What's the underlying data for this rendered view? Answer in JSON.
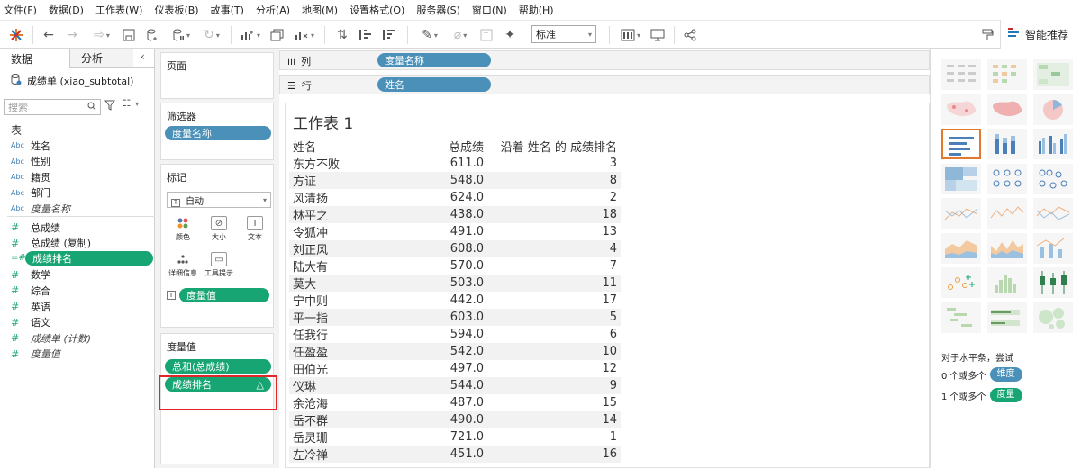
{
  "menu": [
    "文件(F)",
    "数据(D)",
    "工作表(W)",
    "仪表板(B)",
    "故事(T)",
    "分析(A)",
    "地图(M)",
    "设置格式(O)",
    "服务器(S)",
    "窗口(N)",
    "帮助(H)"
  ],
  "toolbar": {
    "view_size": "标准",
    "smart_tab": "智能推荐"
  },
  "data_pane": {
    "tab_data": "数据",
    "tab_analysis": "分析",
    "datasource": "成绩单 (xiao_subtotal)",
    "search_placeholder": "搜索",
    "table_heading": "表",
    "dimensions": [
      {
        "type": "Abc",
        "name": "姓名"
      },
      {
        "type": "Abc",
        "name": "性别"
      },
      {
        "type": "Abc",
        "name": "籍贯"
      },
      {
        "type": "Abc",
        "name": "部门"
      },
      {
        "type": "Abc",
        "name": "度量名称"
      }
    ],
    "measures": [
      {
        "type": "#",
        "name": "总成绩"
      },
      {
        "type": "#",
        "name": "总成绩 (复制)"
      },
      {
        "type": "=#",
        "name": "成绩排名"
      },
      {
        "type": "#",
        "name": "数学"
      },
      {
        "type": "#",
        "name": "综合"
      },
      {
        "type": "#",
        "name": "英语"
      },
      {
        "type": "#",
        "name": "语文"
      },
      {
        "type": "#",
        "name": "成绩单 (计数)"
      },
      {
        "type": "#",
        "name": "度量值"
      }
    ]
  },
  "mid_pane": {
    "pages_title": "页面",
    "filters_title": "筛选器",
    "filter_pill": "度量名称",
    "marks_title": "标记",
    "mark_type": "自动",
    "mark_buttons": [
      "颜色",
      "大小",
      "文本",
      "详细信息",
      "工具提示"
    ],
    "marks_pill": "度量值",
    "measure_values_title": "度量值",
    "mv_pills": [
      "总和(总成绩)",
      "成绩排名"
    ],
    "delta_symbol": "△"
  },
  "shelves": {
    "columns_label": "列",
    "columns_pill": "度量名称",
    "rows_label": "行",
    "rows_pill": "姓名"
  },
  "sheet": {
    "title": "工作表 1",
    "headers": [
      "姓名",
      "总成绩",
      "沿着 姓名 的 成绩排名"
    ],
    "rows": [
      [
        "东方不败",
        "611.0",
        "3"
      ],
      [
        "方证",
        "548.0",
        "8"
      ],
      [
        "风清扬",
        "624.0",
        "2"
      ],
      [
        "林平之",
        "438.0",
        "18"
      ],
      [
        "令狐冲",
        "491.0",
        "13"
      ],
      [
        "刘正风",
        "608.0",
        "4"
      ],
      [
        "陆大有",
        "570.0",
        "7"
      ],
      [
        "莫大",
        "503.0",
        "11"
      ],
      [
        "宁中则",
        "442.0",
        "17"
      ],
      [
        "平一指",
        "603.0",
        "5"
      ],
      [
        "任我行",
        "594.0",
        "6"
      ],
      [
        "任盈盈",
        "542.0",
        "10"
      ],
      [
        "田伯光",
        "497.0",
        "12"
      ],
      [
        "仪琳",
        "544.0",
        "9"
      ],
      [
        "余沧海",
        "487.0",
        "15"
      ],
      [
        "岳不群",
        "490.0",
        "14"
      ],
      [
        "岳灵珊",
        "721.0",
        "1"
      ],
      [
        "左冷禅",
        "451.0",
        "16"
      ]
    ]
  },
  "show_me": {
    "hint": "对于水平条，尝试",
    "dim_prefix": "0 个或多个",
    "dim_pill": "维度",
    "measure_prefix": "1 个或多个",
    "measure_pill": "度量"
  },
  "colors": {
    "accent_green": "#17a673",
    "accent_blue": "#4a90b8",
    "highlight_red": "#e0262b",
    "selection_orange": "#e2792e"
  }
}
